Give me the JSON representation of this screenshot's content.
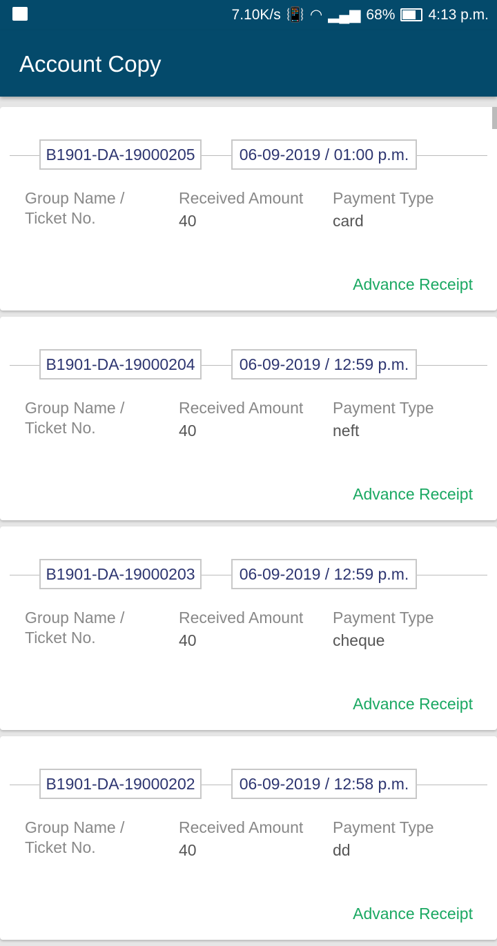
{
  "status_bar": {
    "speed": "7.10K/s",
    "battery": "68%",
    "battery_level": 0.68,
    "time": "4:13 p.m.",
    "icons": [
      "image-icon",
      "vibrate-icon",
      "wifi-icon",
      "signal-icon",
      "hd-call-icon",
      "signal-icon",
      "battery-icon"
    ]
  },
  "app_bar": {
    "title": "Account Copy"
  },
  "receipts": [
    {
      "receipt_no": "B1901-DA-19000205",
      "datetime": "06-09-2019 / 01:00 p.m.",
      "group_label": "Group Name /\nTicket No.",
      "group_value": "",
      "amount_label": "Received Amount",
      "amount": "40",
      "type_label": "Payment Type",
      "type": "card",
      "action": "Advance Receipt"
    },
    {
      "receipt_no": "B1901-DA-19000204",
      "datetime": "06-09-2019 / 12:59 p.m.",
      "group_label": "Group Name /\nTicket No.",
      "group_value": "",
      "amount_label": "Received Amount",
      "amount": "40",
      "type_label": "Payment Type",
      "type": "neft",
      "action": "Advance Receipt"
    },
    {
      "receipt_no": "B1901-DA-19000203",
      "datetime": "06-09-2019 / 12:59 p.m.",
      "group_label": "Group Name /\nTicket No.",
      "group_value": "",
      "amount_label": "Received Amount",
      "amount": "40",
      "type_label": "Payment Type",
      "type": "cheque",
      "action": "Advance Receipt"
    },
    {
      "receipt_no": "B1901-DA-19000202",
      "datetime": "06-09-2019 / 12:58 p.m.",
      "group_label": "Group Name /\nTicket No.",
      "group_value": "",
      "amount_label": "Received Amount",
      "amount": "40",
      "type_label": "Payment Type",
      "type": "dd",
      "action": "Advance Receipt"
    }
  ],
  "colors": {
    "primary": "#044a6b",
    "accent": "#1aa862",
    "id_text": "#2d3570"
  }
}
